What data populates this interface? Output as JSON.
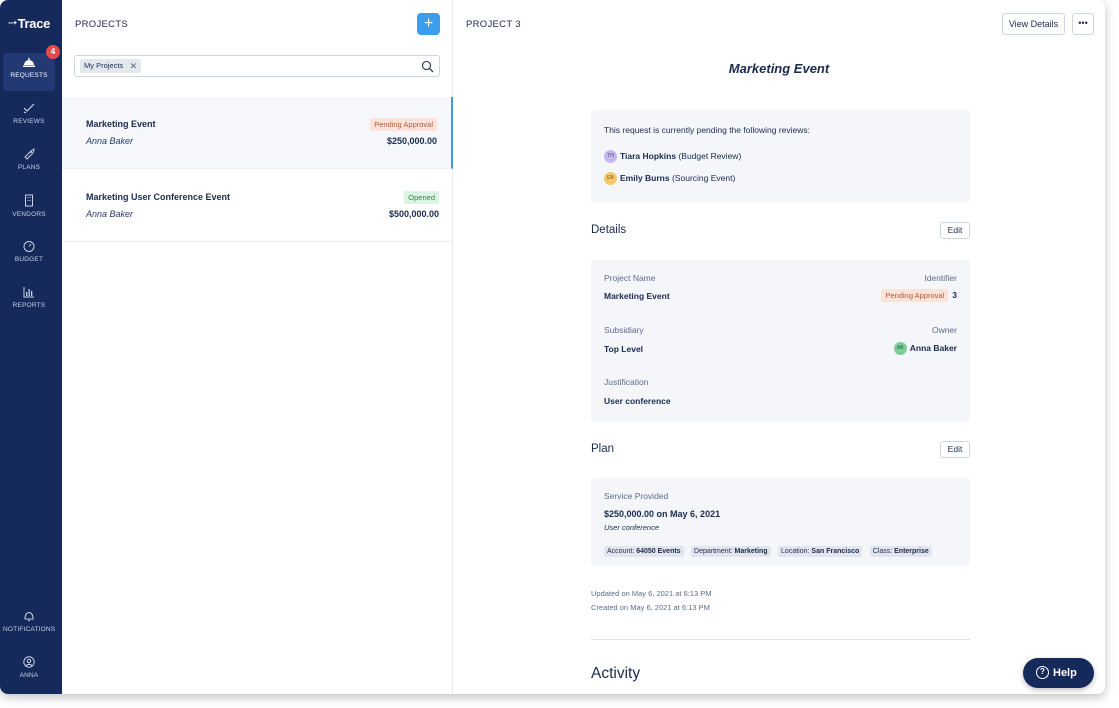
{
  "app": {
    "logo": "Trace"
  },
  "sidebar": {
    "items": [
      {
        "label": "REQUESTS",
        "icon": "bell-icon",
        "active": true,
        "badge": "4"
      },
      {
        "label": "REVIEWS",
        "icon": "check-icon"
      },
      {
        "label": "PLANS",
        "icon": "rocket-icon"
      },
      {
        "label": "VENDORS",
        "icon": "building-icon"
      },
      {
        "label": "BUDGET",
        "icon": "gauge-icon"
      },
      {
        "label": "REPORTS",
        "icon": "bar-chart-icon"
      }
    ],
    "bottom": [
      {
        "label": "NOTIFICATIONS",
        "icon": "bell-outline-icon"
      },
      {
        "label": "ANNA",
        "icon": "user-icon"
      }
    ]
  },
  "projects_panel": {
    "title": "PROJECTS",
    "add_label": "+",
    "filter_chip": "My Projects",
    "items": [
      {
        "name": "Marketing Event",
        "owner": "Anna Baker",
        "amount": "$250,000.00",
        "status": "Pending Approval"
      },
      {
        "name": "Marketing User Conference Event",
        "owner": "Anna Baker",
        "amount": "$500,000.00",
        "status": "Opened"
      }
    ]
  },
  "detail": {
    "header": "PROJECT 3",
    "view_details": "View Details",
    "more": "•••",
    "title": "Marketing Event",
    "pending": {
      "intro": "This request is currently pending the following reviews:",
      "reviewers": [
        {
          "initials": "TH",
          "name": "Tiara Hopkins",
          "role": "(Budget Review)",
          "color": "#c6b7ef"
        },
        {
          "initials": "EB",
          "name": "Emily Burns",
          "role": "(Sourcing Event)",
          "color": "#f4c86b"
        }
      ]
    },
    "details_section": {
      "title": "Details",
      "edit": "Edit",
      "project_name_label": "Project Name",
      "project_name": "Marketing Event",
      "identifier_label": "Identifier",
      "identifier_status": "Pending Approval",
      "identifier": "3",
      "subsidiary_label": "Subsidiary",
      "subsidiary": "Top Level",
      "owner_label": "Owner",
      "owner_initials": "AB",
      "owner": "Anna Baker",
      "justification_label": "Justification",
      "justification": "User conference"
    },
    "plan_section": {
      "title": "Plan",
      "edit": "Edit",
      "service_label": "Service Provided",
      "amount_line": "$250,000.00 on May 6, 2021",
      "note": "User conference",
      "tags": [
        {
          "key": "Account:",
          "value": "64050 Events"
        },
        {
          "key": "Department:",
          "value": "Marketing"
        },
        {
          "key": "Location:",
          "value": "San Francisco"
        },
        {
          "key": "Class:",
          "value": "Enterprise"
        }
      ]
    },
    "updated": "Updated on May 6, 2021 at 6:13 PM",
    "created": "Created on May 6, 2021 at 6:13 PM",
    "activity_title": "Activity"
  },
  "help_label": "Help",
  "colors": {
    "sidebar": "#15295b",
    "accent": "#3b9dec",
    "pending_bg": "#fbe3d9",
    "opened_bg": "#ddf3e4"
  }
}
